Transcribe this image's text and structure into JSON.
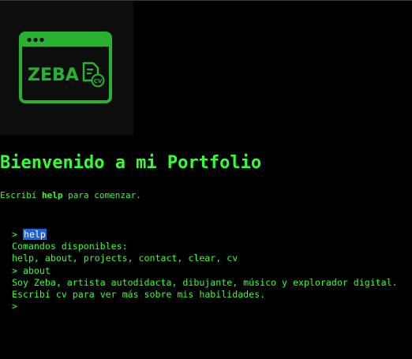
{
  "logo": {
    "text": "ZEBA",
    "badge": "CV",
    "colors": {
      "accent": "#29b22f",
      "background": "#0d0d0d"
    }
  },
  "title": "Bienvenido a mi Portfolio",
  "intro": {
    "before": "Escribí ",
    "command": "help",
    "after": " para comenzar."
  },
  "terminal": {
    "prompt": ">",
    "lines": [
      {
        "type": "input",
        "text": "help"
      },
      {
        "type": "output",
        "text": "Comandos disponibles:"
      },
      {
        "type": "output",
        "text": "help, about, projects, contact, clear, cv"
      },
      {
        "type": "input",
        "text": "about"
      },
      {
        "type": "output",
        "text": "Soy Zeba, artista autodidacta, dibujante, músico y explorador digital."
      },
      {
        "type": "output",
        "before": "Escribí ",
        "command": "cv",
        "after": " para ver más sobre mis habilidades."
      }
    ],
    "current_input": ""
  },
  "colors": {
    "text": "#33ff33",
    "background": "#000000",
    "selection": "#1e63d6"
  }
}
